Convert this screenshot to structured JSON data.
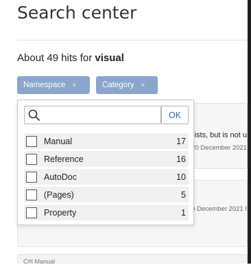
{
  "header": {
    "title": "Search center"
  },
  "summary": {
    "prefix": "About 49 hits for ",
    "query": "visual"
  },
  "filters": [
    {
      "label": "Namespace",
      "remove": "×"
    },
    {
      "label": "Category",
      "remove": "×"
    }
  ],
  "dropdown": {
    "search_value": "",
    "ok_label": "OK",
    "options": [
      {
        "label": "Manual",
        "count": "17"
      },
      {
        "label": "Reference",
        "count": "16"
      },
      {
        "label": "AutoDoc",
        "count": "10"
      },
      {
        "label": "(Pages)",
        "count": "5"
      },
      {
        "label": "Property",
        "count": "1"
      }
    ]
  },
  "results": [
    {
      "snippet": "ists, but is not u",
      "date": "20 December 2021"
    },
    {
      "date": "0 December 2021 I"
    }
  ],
  "next_result": {
    "title": "C#I Manual"
  },
  "colors": {
    "chip": "#8aa6cc",
    "ok": "#3366aa"
  }
}
